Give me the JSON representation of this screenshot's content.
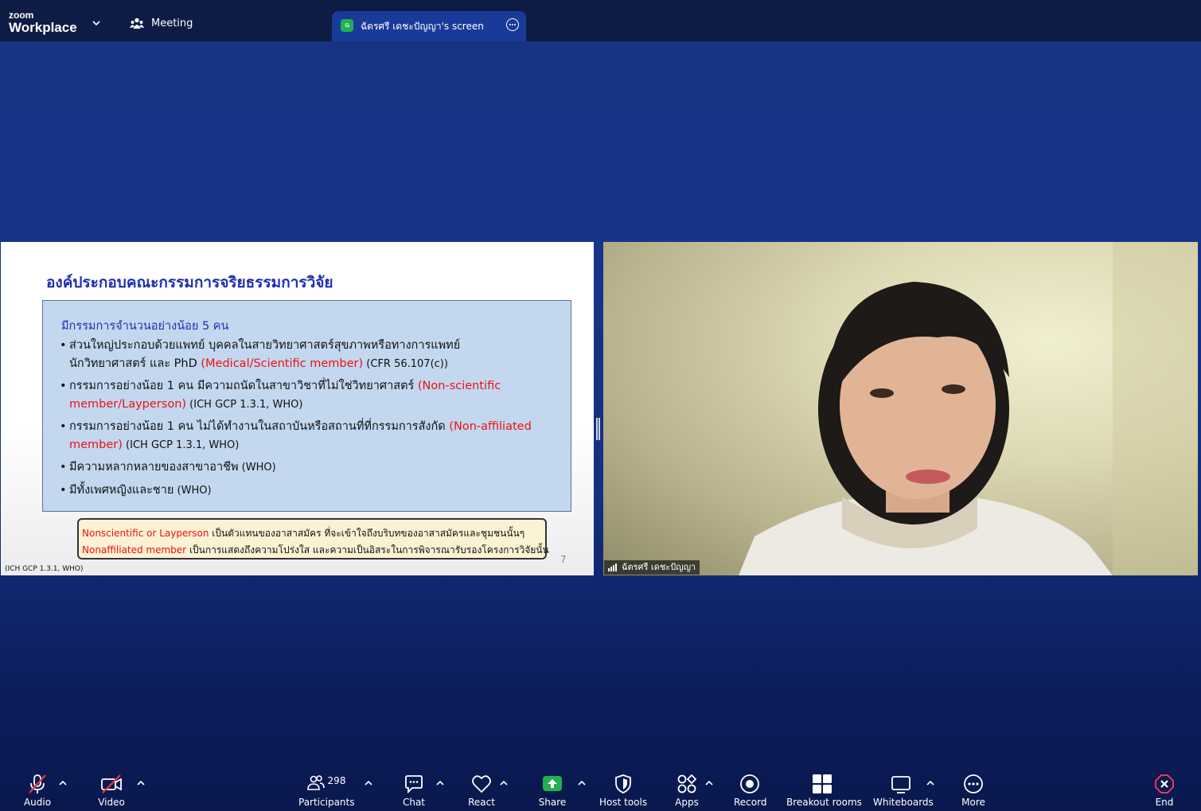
{
  "app": {
    "logo_top": "zoom",
    "logo_bottom": "Workplace",
    "meeting_tab_label": "Meeting",
    "share_tab_badge": "ฉ",
    "share_tab_title": "ฉัตรศรี เดชะปัญญา's screen"
  },
  "slide": {
    "title": "องค์ประกอบคณะกรรมการจริยธรรมการวิจัย",
    "box_heading": "มีกรรมการจำนวนอย่างน้อย 5 คน",
    "bullets": [
      {
        "line1": "ส่วนใหญ่ประกอบด้วยแพทย์ บุคคลในสายวิทยาศาสตร์สุขภาพหรือทางการแพทย์",
        "line2_text": "นักวิทยาศาสตร์ และ PhD ",
        "line2_red": "(Medical/Scientific member)",
        "line2_ref": " (CFR 56.107(c))"
      },
      {
        "line1_text": "กรรมการอย่างน้อย 1 คน มีความถนัดในสาขาวิชาที่ไม่ใช่วิทยาศาสตร์ ",
        "line1_red": "(Non-scientific",
        "line2_red": "member/Layperson)",
        "line2_ref": " (ICH GCP 1.3.1, WHO)"
      },
      {
        "line1_text": "กรรมการอย่างน้อย 1 คน ไม่ได้ทำงานในสถาบันหรือสถานที่ที่กรรมการสังกัด ",
        "line1_red": "(Non-affiliated",
        "line2_red": "member)",
        "line2_ref": " (ICH GCP 1.3.1, WHO)"
      },
      {
        "line1_text": "มีความหลากหลายของสาขาอาชีพ",
        "line1_ref": " (WHO)"
      },
      {
        "line1_text": "มีทั้งเพศหญิงและชาย",
        "line1_ref": " (WHO)"
      }
    ],
    "bullet_char": "•",
    "note_line1_red": "Nonscientific or Layperson",
    "note_line1_text": " เป็นตัวแทนของอาสาสมัคร ที่จะเข้าใจถึงบริบทของอาสาสมัครและชุมชนนั้นๆ",
    "note_line2_red": "Nonaffiliated member",
    "note_line2_text": " เป็นการแสดงถึงความโปร่งใส และความเป็นอิสระในการพิจารณารับรองโครงการวิจัยนั้น",
    "page_number": "7",
    "footer_ref": "(ICH GCP 1.3.1, WHO)"
  },
  "video": {
    "participant_name": "ฉัตรศรี เดชะปัญญา"
  },
  "toolbar": {
    "audio": "Audio",
    "video": "Video",
    "participants": "Participants",
    "participants_count": "298",
    "chat": "Chat",
    "react": "React",
    "share": "Share",
    "host_tools": "Host tools",
    "apps": "Apps",
    "record": "Record",
    "breakout_rooms": "Breakout rooms",
    "whiteboards": "Whiteboards",
    "more": "More",
    "end": "End"
  },
  "icons": {
    "audio": "microphone-muted-icon",
    "video": "camera-off-icon",
    "participants": "people-icon",
    "chat": "chat-bubble-icon",
    "react": "heart-icon",
    "share": "share-arrow-icon",
    "host_tools": "shield-icon",
    "apps": "apps-icon",
    "record": "record-icon",
    "breakout_rooms": "grid-icon",
    "whiteboards": "whiteboard-icon",
    "more": "ellipsis-icon",
    "end": "end-icon"
  },
  "colors": {
    "accent_share": "#22b052",
    "end_red": "#e8374e",
    "muted_red": "#ee3344",
    "slide_title_blue": "#1f2fb0",
    "slide_red": "#e11111"
  }
}
